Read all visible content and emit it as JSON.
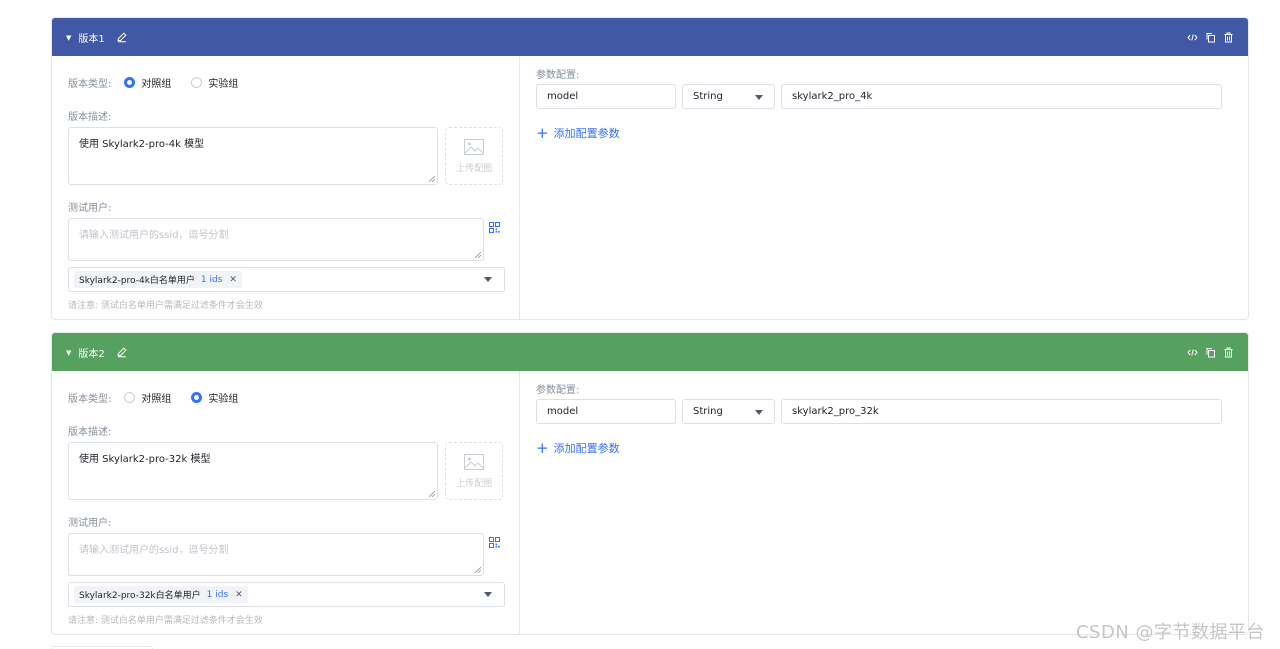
{
  "versions": [
    {
      "title": "版本1",
      "type_label": "版本类型:",
      "type_options": [
        "对照组",
        "实验组"
      ],
      "selected_type": "对照组",
      "description_label": "版本描述:",
      "description_value": "使用 Skylark2-pro-4k 模型",
      "upload_label": "上传配图",
      "test_users_label": "测试用户:",
      "test_users_placeholder": "请输入测试用户的ssid，逗号分割",
      "whitelist_tag": "Skylark2-pro-4k白名单用户",
      "whitelist_count": "1 ids",
      "note": "请注意: 测试白名单用户需满足过滤条件才会生效",
      "params_label": "参数配置:",
      "params": [
        {
          "key": "model",
          "type": "String",
          "value": "skylark2_pro_4k"
        }
      ],
      "add_param_label": "添加配置参数"
    },
    {
      "title": "版本2",
      "type_label": "版本类型:",
      "type_options": [
        "对照组",
        "实验组"
      ],
      "selected_type": "实验组",
      "description_label": "版本描述:",
      "description_value": "使用 Skylark2-pro-32k 模型",
      "upload_label": "上传配图",
      "test_users_label": "测试用户:",
      "test_users_placeholder": "请输入测试用户的ssid，逗号分割",
      "whitelist_tag": "Skylark2-pro-32k白名单用户",
      "whitelist_count": "1 ids",
      "note": "请注意: 测试白名单用户需满足过滤条件才会生效",
      "params_label": "参数配置:",
      "params": [
        {
          "key": "model",
          "type": "String",
          "value": "skylark2_pro_32k"
        }
      ],
      "add_param_label": "添加配置参数"
    }
  ],
  "header_icons": [
    "code-icon",
    "copy-icon",
    "delete-icon"
  ],
  "colors": {
    "version1_header": "#4058a6",
    "version2_header": "#57a160",
    "accent": "#3370ff"
  },
  "watermark": "CSDN @字节数据平台"
}
